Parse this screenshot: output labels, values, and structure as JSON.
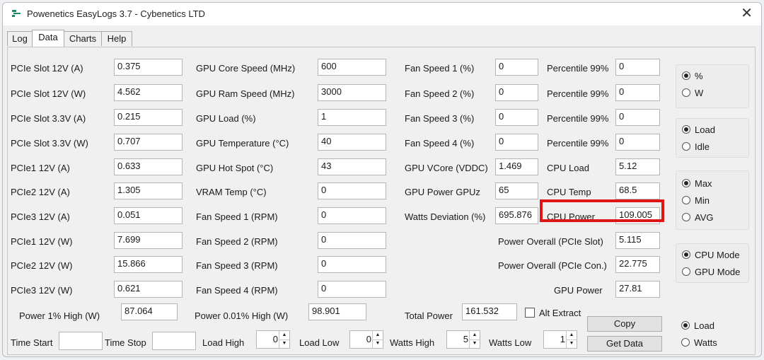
{
  "window": {
    "title": "Powenetics EasyLogs 3.7 - Cybenetics LTD",
    "close_glyph": "✕"
  },
  "tabs": [
    {
      "label": "Log"
    },
    {
      "label": "Data"
    },
    {
      "label": "Charts"
    },
    {
      "label": "Help"
    }
  ],
  "active_tab": "Data",
  "col1": [
    {
      "label": "PCIe Slot 12V (A)",
      "value": "0.375"
    },
    {
      "label": "PCIe Slot 12V (W)",
      "value": "4.562"
    },
    {
      "label": "PCIe Slot 3.3V (A)",
      "value": "0.215"
    },
    {
      "label": "PCIe Slot 3.3V (W)",
      "value": "0.707"
    },
    {
      "label": "PCIe1 12V (A)",
      "value": "0.633"
    },
    {
      "label": "PCIe2 12V (A)",
      "value": "1.305"
    },
    {
      "label": "PCIe3 12V (A)",
      "value": "0.051"
    },
    {
      "label": "PCIe1 12V (W)",
      "value": "7.699"
    },
    {
      "label": "PCIe2 12V (W)",
      "value": "15.866"
    },
    {
      "label": "PCIe3 12V (W)",
      "value": "0.621"
    }
  ],
  "col2": [
    {
      "label": "GPU Core Speed (MHz)",
      "value": "600"
    },
    {
      "label": "GPU Ram Speed (MHz)",
      "value": "3000"
    },
    {
      "label": "GPU Load (%)",
      "value": "1"
    },
    {
      "label": "GPU Temperature (°C)",
      "value": "40"
    },
    {
      "label": "GPU Hot Spot (°C)",
      "value": "43"
    },
    {
      "label": "VRAM Temp (°C)",
      "value": "0"
    },
    {
      "label": "Fan Speed 1 (RPM)",
      "value": "0"
    },
    {
      "label": "Fan Speed 2 (RPM)",
      "value": "0"
    },
    {
      "label": "Fan Speed 3 (RPM)",
      "value": "0"
    },
    {
      "label": "Fan Speed 4 (RPM)",
      "value": "0"
    }
  ],
  "col3": [
    {
      "label": "Fan Speed 1 (%)",
      "value": "0"
    },
    {
      "label": "Fan Speed 2 (%)",
      "value": "0"
    },
    {
      "label": "Fan Speed 3 (%)",
      "value": "0"
    },
    {
      "label": "Fan Speed 4 (%)",
      "value": "0"
    },
    {
      "label": "GPU VCore (VDDC)",
      "value": "1.469"
    },
    {
      "label": "GPU Power GPUz",
      "value": "65"
    },
    {
      "label": "Watts Deviation (%)",
      "value": "695.876"
    }
  ],
  "col4": [
    {
      "label": "Percentile 99%",
      "value": "0"
    },
    {
      "label": "Percentile 99%",
      "value": "0"
    },
    {
      "label": "Percentile 99%",
      "value": "0"
    },
    {
      "label": "Percentile 99%",
      "value": "0"
    },
    {
      "label": "CPU Load",
      "value": "5.12"
    },
    {
      "label": "CPU Temp",
      "value": "68.5"
    },
    {
      "label": "CPU Power",
      "value": "109.005"
    }
  ],
  "col4_lower": [
    {
      "label": "Power Overall (PCIe Slot)",
      "value": "5.115"
    },
    {
      "label": "Power Overall (PCIe Con.)",
      "value": "22.775"
    },
    {
      "label": "GPU Power",
      "value": "27.81"
    }
  ],
  "bottom_row": {
    "power1": {
      "label": "Power 1% High (W)",
      "value": "87.064"
    },
    "power001": {
      "label": "Power 0.01% High (W)",
      "value": "98.901"
    },
    "total": {
      "label": "Total Power",
      "value": "161.532"
    },
    "alt_extract": "Alt Extract"
  },
  "footer": {
    "time_start": "Time Start",
    "time_stop": "Time Stop",
    "load_high": {
      "label": "Load High",
      "value": "0"
    },
    "load_low": {
      "label": "Load Low",
      "value": "0"
    },
    "watts_high": {
      "label": "Watts High",
      "value": "5"
    },
    "watts_low": {
      "label": "Watts Low",
      "value": "1"
    }
  },
  "buttons": {
    "copy": "Copy",
    "get_data": "Get Data"
  },
  "radio_groups": {
    "unit": [
      {
        "label": "%",
        "checked": true
      },
      {
        "label": "W",
        "checked": false
      }
    ],
    "state": [
      {
        "label": "Load",
        "checked": true
      },
      {
        "label": "Idle",
        "checked": false
      }
    ],
    "stat": [
      {
        "label": "Max",
        "checked": true
      },
      {
        "label": "Min",
        "checked": false
      },
      {
        "label": "AVG",
        "checked": false
      }
    ],
    "mode": [
      {
        "label": "CPU Mode",
        "checked": true
      },
      {
        "label": "GPU Mode",
        "checked": false
      }
    ],
    "axis": [
      {
        "label": "Load",
        "checked": true
      },
      {
        "label": "Watts",
        "checked": false
      }
    ]
  },
  "colors": {
    "highlight": "#e01515",
    "app_icon": "#1f8a6a"
  }
}
